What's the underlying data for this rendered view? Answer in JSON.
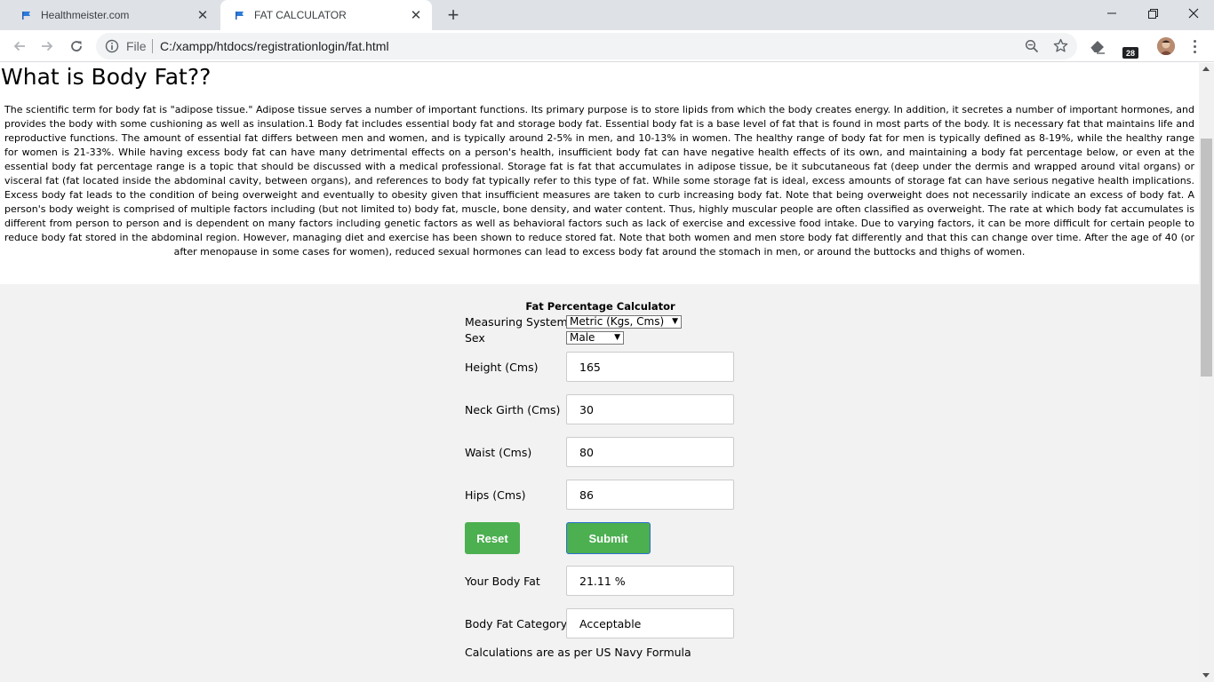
{
  "browser": {
    "tabs": [
      {
        "title": "Healthmeister.com",
        "active": false
      },
      {
        "title": "FAT CALCULATOR",
        "active": true
      }
    ],
    "omnibox": {
      "scheme_label": "File",
      "url": "C:/xampp/htdocs/registrationlogin/fat.html"
    },
    "extension_badge": "28"
  },
  "page": {
    "title": "What is Body Fat??",
    "article": "The scientific term for body fat is \"adipose tissue.\" Adipose tissue serves a number of important functions. Its primary purpose is to store lipids from which the body creates energy. In addition, it secretes a number of important hormones, and provides the body with some cushioning as well as insulation.1 Body fat includes essential body fat and storage body fat. Essential body fat is a base level of fat that is found in most parts of the body. It is necessary fat that maintains life and reproductive functions. The amount of essential fat differs between men and women, and is typically around 2-5% in men, and 10-13% in women. The healthy range of body fat for men is typically defined as 8-19%, while the healthy range for women is 21-33%. While having excess body fat can have many detrimental effects on a person's health, insufficient body fat can have negative health effects of its own, and maintaining a body fat percentage below, or even at the essential body fat percentage range is a topic that should be discussed with a medical professional. Storage fat is fat that accumulates in adipose tissue, be it subcutaneous fat (deep under the dermis and wrapped around vital organs) or visceral fat (fat located inside the abdominal cavity, between organs), and references to body fat typically refer to this type of fat. While some storage fat is ideal, excess amounts of storage fat can have serious negative health implications. Excess body fat leads to the condition of being overweight and eventually to obesity given that insufficient measures are taken to curb increasing body fat. Note that being overweight does not necessarily indicate an excess of body fat. A person's body weight is comprised of multiple factors including (but not limited to) body fat, muscle, bone density, and water content. Thus, highly muscular people are often classified as overweight. The rate at which body fat accumulates is different from person to person and is dependent on many factors including genetic factors as well as behavioral factors such as lack of exercise and excessive food intake. Due to varying factors, it can be more difficult for certain people to reduce body fat stored in the abdominal region. However, managing diet and exercise has been shown to reduce stored fat. Note that both women and men store body fat differently and that this can change over time. After the age of 40 (or after menopause in some cases for women), reduced sexual hormones can lead to excess body fat around the stomach in men, or around the buttocks and thighs of women."
  },
  "calculator": {
    "title": "Fat Percentage Calculator",
    "measuring_system": {
      "label": "Measuring System",
      "selected": "Metric (Kgs, Cms)"
    },
    "sex": {
      "label": "Sex",
      "selected": "Male"
    },
    "height": {
      "label": "Height (Cms)",
      "value": "165"
    },
    "neck": {
      "label": "Neck Girth (Cms)",
      "value": "30"
    },
    "waist": {
      "label": "Waist (Cms)",
      "value": "80"
    },
    "hips": {
      "label": "Hips (Cms)",
      "value": "86"
    },
    "reset_label": "Reset",
    "submit_label": "Submit",
    "body_fat": {
      "label": "Your Body Fat",
      "value": "21.11 %"
    },
    "category": {
      "label": "Body Fat Category",
      "value": "Acceptable"
    },
    "footnote": "Calculations are as per US Navy Formula"
  },
  "colors": {
    "button_green": "#4caf50",
    "panel_bg": "#f2f2f2",
    "tabstrip_bg": "#dee1e6"
  }
}
